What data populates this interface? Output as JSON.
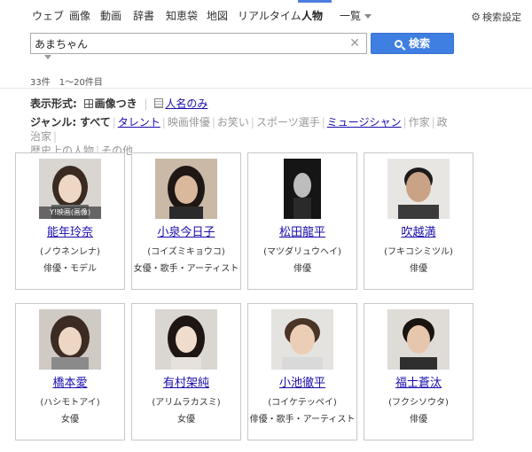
{
  "nav": {
    "tabs": [
      {
        "label": "ウェブ"
      },
      {
        "label": "画像"
      },
      {
        "label": "動画"
      },
      {
        "label": "辞書"
      },
      {
        "label": "知恵袋"
      },
      {
        "label": "地図"
      },
      {
        "label": "リアルタイム"
      },
      {
        "label": "人物"
      },
      {
        "label": "一覧"
      }
    ],
    "active_tab": "人物",
    "settings_label": "検索設定"
  },
  "search": {
    "query": "あまちゃん",
    "button_label": "検索"
  },
  "results": {
    "count": "33件",
    "range": "1〜20件目"
  },
  "format": {
    "label": "表示形式:",
    "option_images": "画像つき",
    "option_names": "人名のみ"
  },
  "genre": {
    "label": "ジャンル:",
    "items": [
      {
        "label": "すべて"
      },
      {
        "label": "タレント"
      },
      {
        "label": "映画俳優"
      },
      {
        "label": "お笑い"
      },
      {
        "label": "スポーツ選手"
      },
      {
        "label": "ミュージシャン"
      },
      {
        "label": "作家"
      },
      {
        "label": "政治家"
      },
      {
        "label": "歴史上の人物"
      },
      {
        "label": "その他"
      }
    ]
  },
  "people": [
    {
      "name": "能年玲奈",
      "reading": "(ノウネンレナ)",
      "job": "俳優・モデル",
      "photo_credit": "Y!映画(画像)"
    },
    {
      "name": "小泉今日子",
      "reading": "(コイズミキョウコ)",
      "job": "女優・歌手・アーティスト",
      "photo_credit": ""
    },
    {
      "name": "松田龍平",
      "reading": "(マツダリュウヘイ)",
      "job": "俳優",
      "photo_credit": ""
    },
    {
      "name": "吹越満",
      "reading": "(フキコシミツル)",
      "job": "俳優",
      "photo_credit": ""
    },
    {
      "name": "橋本愛",
      "reading": "(ハシモトアイ)",
      "job": "女優",
      "photo_credit": ""
    },
    {
      "name": "有村架純",
      "reading": "(アリムラカスミ)",
      "job": "女優",
      "photo_credit": ""
    },
    {
      "name": "小池徹平",
      "reading": "(コイケテッペイ)",
      "job": "俳優・歌手・アーティスト",
      "photo_credit": ""
    },
    {
      "name": "福士蒼汰",
      "reading": "(フクシソウタ)",
      "job": "俳優",
      "photo_credit": ""
    }
  ],
  "colors": {
    "accent": "#3f7fe2",
    "link": "#1a0dab"
  }
}
